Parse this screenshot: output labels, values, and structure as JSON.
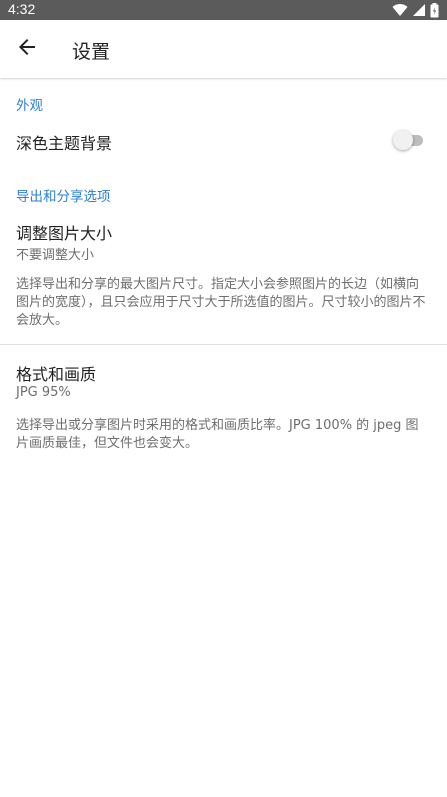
{
  "status_bar": {
    "time": "4:32",
    "icons": [
      "wifi-icon",
      "signal-icon",
      "battery-icon"
    ]
  },
  "app_bar": {
    "back_icon": "arrow-left-icon",
    "title": "设置"
  },
  "sections": {
    "appearance": {
      "header": "外观",
      "dark_theme": {
        "title": "深色主题背景",
        "enabled": false
      }
    },
    "export_share": {
      "header": "导出和分享选项",
      "resize": {
        "title": "调整图片大小",
        "summary": "不要调整大小",
        "description": "选择导出和分享的最大图片尺寸。指定大小会参照图片的长边（如横向图片的宽度），且只会应用于尺寸大于所选值的图片。尺寸较小的图片不会放大。"
      },
      "format": {
        "title": "格式和画质",
        "summary": "JPG 95%",
        "description": "选择导出或分享图片时采用的格式和画质比率。JPG 100% 的 jpeg 图片画质最佳，但文件也会变大。"
      }
    }
  },
  "colors": {
    "accent": "#2d7fd3",
    "status_bar": "#5b5b5b"
  }
}
